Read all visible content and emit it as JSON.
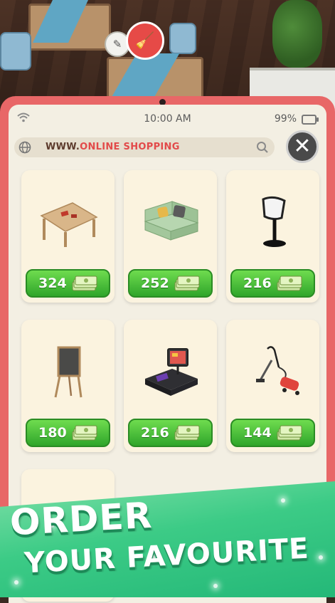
{
  "status_bar": {
    "time": "10:00 AM",
    "battery": "99%"
  },
  "browser": {
    "url_prefix": "WWW.",
    "url_main": "ONLINE SHOPPING"
  },
  "colors": {
    "frame": "#e86767",
    "accent": "#e24a4a",
    "price_button": "#3fb931",
    "promo_banner": "#3ccb86"
  },
  "items": [
    {
      "name_icon": "table-icon",
      "price": "324"
    },
    {
      "name_icon": "sofa-icon",
      "price": "252"
    },
    {
      "name_icon": "bar-stool-icon",
      "price": "216"
    },
    {
      "name_icon": "easel-board-icon",
      "price": "180"
    },
    {
      "name_icon": "cash-register-icon",
      "price": "216"
    },
    {
      "name_icon": "vacuum-cleaner-icon",
      "price": "144"
    }
  ],
  "promo": {
    "line1": "ORDER",
    "line2": "YOUR FAVOURITE"
  }
}
